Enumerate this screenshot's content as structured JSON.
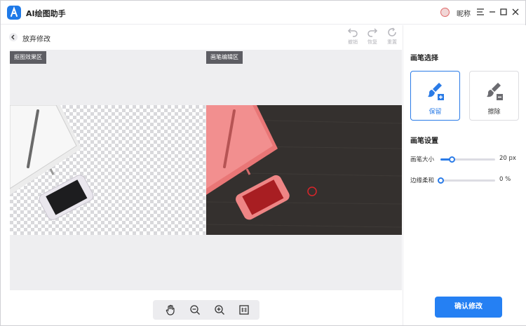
{
  "app": {
    "title": "AI绘图助手",
    "nickname": "昵称"
  },
  "toolbar": {
    "back_label": "放弃修改",
    "undo_label": "撤销",
    "redo_label": "恢复",
    "reset_label": "重置"
  },
  "canvas": {
    "left_tag": "抠图效果区",
    "right_tag": "画笔编辑区"
  },
  "sidebar": {
    "brush_select_title": "画笔选择",
    "keep_label": "保留",
    "erase_label": "擦除",
    "brush_settings_title": "画笔设置",
    "brush_size_label": "画笔大小",
    "brush_size_value": "20 px",
    "brush_size_fraction": 0.2,
    "edge_soft_label": "边缘柔和",
    "edge_soft_value": "0 %",
    "edge_soft_fraction": 0,
    "confirm_label": "确认修改"
  },
  "bottom_tools": [
    "hand-icon",
    "zoom-out-icon",
    "zoom-in-icon",
    "fit-1to1-icon"
  ],
  "colors": {
    "accent": "#2a7be7",
    "highlight": "#f08a8a",
    "tag_bg": "#5d5d63"
  }
}
